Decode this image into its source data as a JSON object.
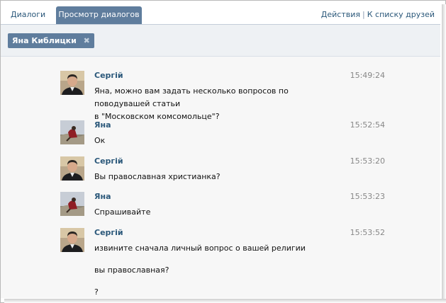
{
  "tabs": {
    "dialogs": "Диалоги",
    "view": "Просмотр диалогов"
  },
  "top_links": {
    "actions": "Действия",
    "separator": "|",
    "friends": "К списку друзей"
  },
  "filter_chip": {
    "label": "Яна Киблицки",
    "remove_glyph": "✖"
  },
  "messages": [
    {
      "author": "Сергій",
      "time": "15:49:24",
      "avatar": "man-avatar",
      "lines": [
        "Яна, можно вам задать несколько вопросов по поводувашей статьи",
        "в \"Московском комсомольце\"?"
      ]
    },
    {
      "author": "Яна",
      "time": "15:52:54",
      "avatar": "woman-avatar",
      "lines": [
        "Ок"
      ]
    },
    {
      "author": "Сергій",
      "time": "15:53:20",
      "avatar": "man-avatar",
      "lines": [
        "Вы православная христианка?"
      ]
    },
    {
      "author": "Яна",
      "time": "15:53:23",
      "avatar": "woman-avatar",
      "lines": [
        "Спрашивайте"
      ]
    },
    {
      "author": "Сергій",
      "time": "15:53:52",
      "avatar": "man-avatar",
      "paragraphs": [
        "извините сначала личный вопрос о вашей религии",
        "вы православная?",
        "?"
      ]
    }
  ],
  "colors": {
    "link": "#2b587a",
    "tab_active": "#5f7d9d",
    "background": "#f7f7f7"
  }
}
